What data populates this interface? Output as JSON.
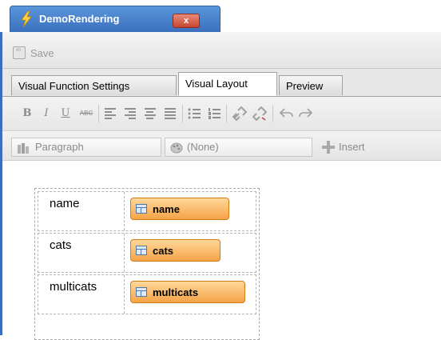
{
  "window": {
    "title": "DemoRendering",
    "close_label": "x"
  },
  "toolbar": {
    "save_label": "Save"
  },
  "tabs": [
    {
      "label": "Visual Function Settings",
      "active": false
    },
    {
      "label": "Visual Layout",
      "active": true
    },
    {
      "label": "Preview",
      "active": false
    }
  ],
  "format": {
    "bold": "B",
    "italic": "I",
    "underline": "U",
    "strike": "ABC"
  },
  "stylebar": {
    "paragraph": "Paragraph",
    "style": "(None)",
    "insert": "Insert"
  },
  "layout_rows": [
    {
      "label": "name",
      "field": "name"
    },
    {
      "label": "cats",
      "field": "cats"
    },
    {
      "label": "multicats",
      "field": "multicats"
    }
  ],
  "colors": {
    "accent": "#3a6fbd",
    "field_pill": "#f6a347"
  }
}
